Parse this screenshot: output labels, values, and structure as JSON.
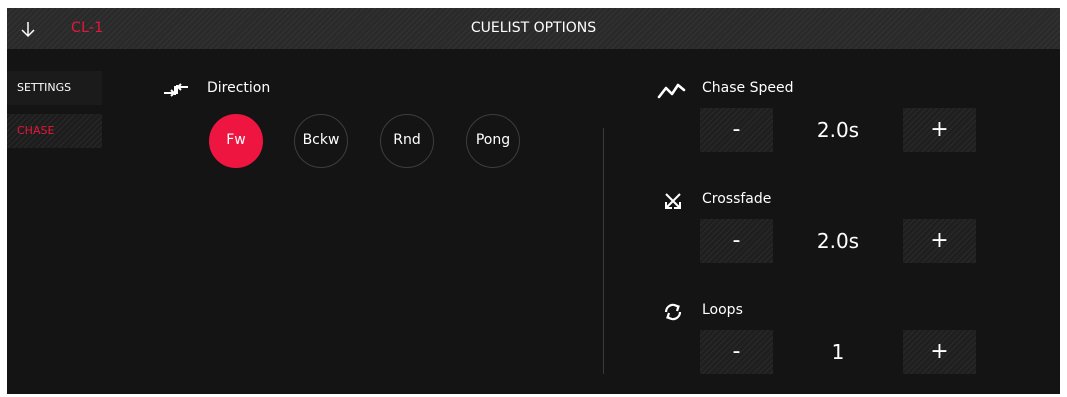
{
  "header": {
    "back_icon": "arrow-down-icon",
    "cue_id": "CL-1",
    "title": "CUELIST OPTIONS"
  },
  "sidebar": {
    "items": [
      {
        "label": "SETTINGS",
        "active": false
      },
      {
        "label": "CHASE",
        "active": true
      }
    ]
  },
  "direction": {
    "icon": "direction-arrows-icon",
    "label": "Direction",
    "options": [
      {
        "label": "Fw",
        "selected": true
      },
      {
        "label": "Bckw",
        "selected": false
      },
      {
        "label": "Rnd",
        "selected": false
      },
      {
        "label": "Pong",
        "selected": false
      }
    ]
  },
  "chase_speed": {
    "icon": "chase-speed-icon",
    "label": "Chase Speed",
    "minus": "-",
    "value": "2.0s",
    "plus": "+"
  },
  "crossfade": {
    "icon": "crossfade-icon",
    "label": "Crossfade",
    "minus": "-",
    "value": "2.0s",
    "plus": "+"
  },
  "loops": {
    "icon": "loop-icon",
    "label": "Loops",
    "minus": "-",
    "value": "1",
    "plus": "+"
  },
  "colors": {
    "accent": "#ee1640",
    "background": "#141414",
    "header": "#2a2a2a"
  }
}
